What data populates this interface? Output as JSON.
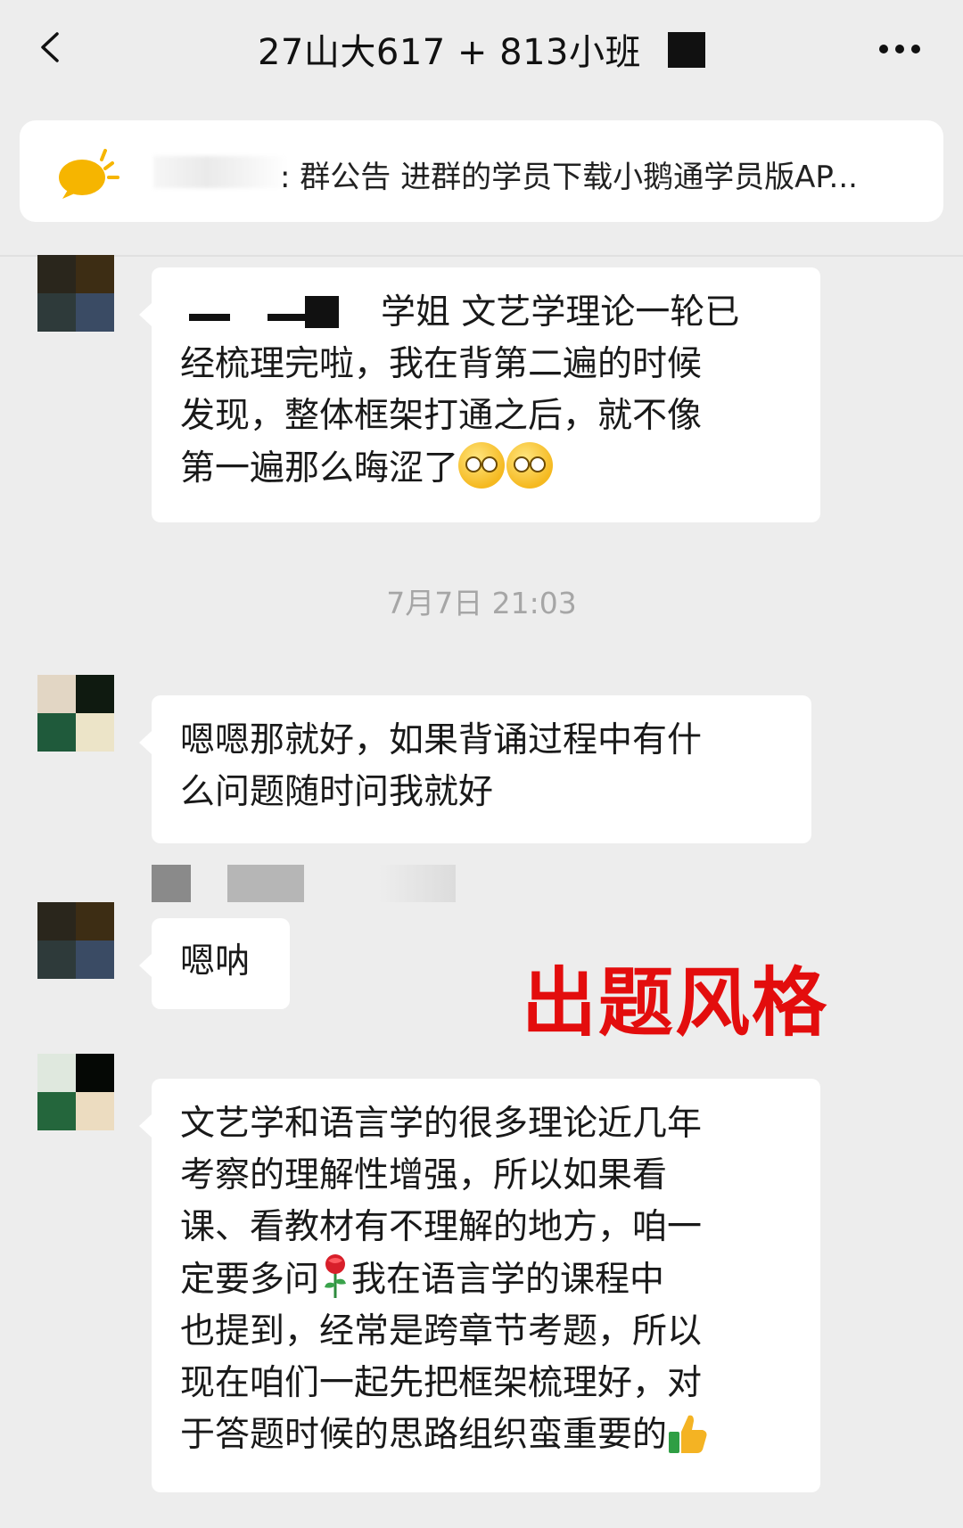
{
  "header": {
    "title": "27山大617 + 813小班",
    "back_icon": "chevron-left-icon",
    "more_icon": "more-dots-icon"
  },
  "notice": {
    "icon": "announcement-speaker-icon",
    "text": ": 群公告 进群的学员下载小鹅通学员版AP..."
  },
  "messages": [
    {
      "text": "学姐 文艺学理论一轮已\n经梳理完啦，我在背第二遍的时候\n发现，整体框架打通之后，就不像\n第一遍那么晦涩了",
      "trailing_emoji": "face-with-monocle-emoji"
    },
    {
      "text": "嗯嗯那就好，如果背诵过程中有什\n么问题随时问我就好"
    },
    {
      "text": "嗯呐"
    },
    {
      "text": "文艺学和语言学的很多理论近几年\n考察的理解性增强，所以如果看\n课、看教材有不理解的地方，咱一\n定要多问",
      "rose_emoji": "rose-emoji",
      "text_after_rose": "我在语言学的课程中\n也提到，经常是跨章节考题，所以\n现在咱们一起先把框架梳理好，对\n于答题时候的思路组织蛮重要的",
      "trailing_emoji": "thumbs-up-emoji"
    }
  ],
  "timestamp": "7月7日 21:03",
  "overlay_label": "出题风格",
  "colors": {
    "background": "#ededed",
    "bubble": "#ffffff",
    "overlay_red": "#e30d0d",
    "timestamp": "#a6a6a6"
  }
}
